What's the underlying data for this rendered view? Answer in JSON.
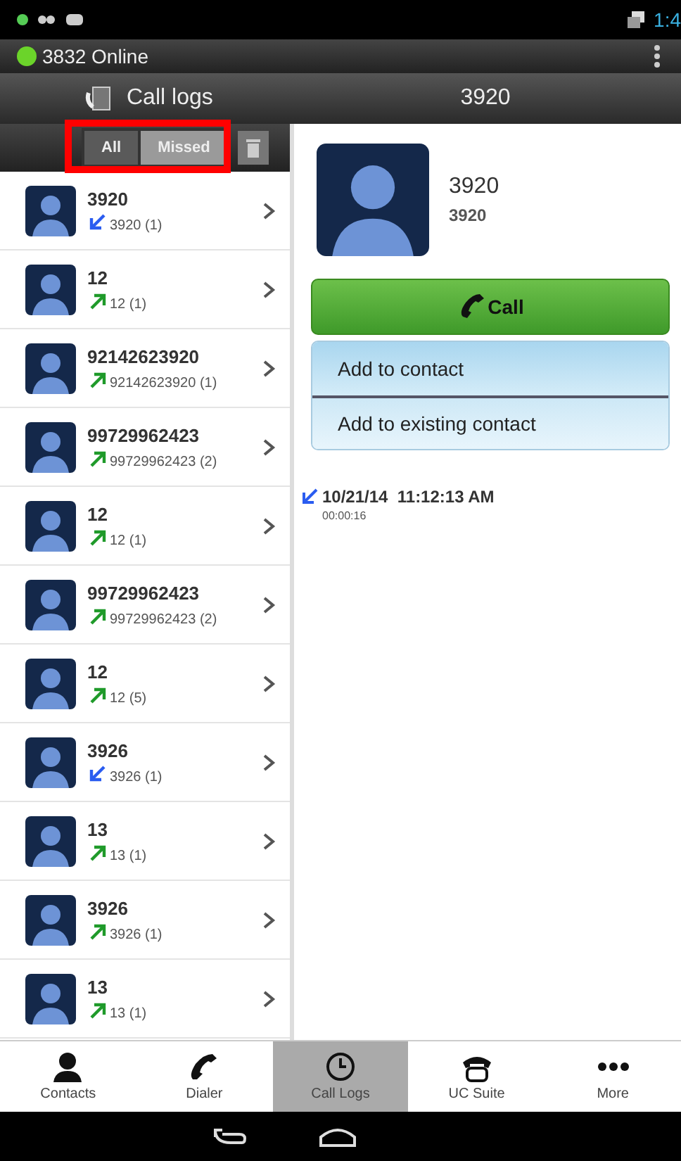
{
  "status_bar": {
    "time": "1:4"
  },
  "account": {
    "name": "3832 Online",
    "online": true
  },
  "header": {
    "title": "Call logs",
    "detail_title": "3920"
  },
  "filter_tabs": [
    {
      "label": "All",
      "selected": false
    },
    {
      "label": "Missed",
      "selected": true
    }
  ],
  "calls": [
    {
      "name": "3920",
      "kind": "incoming",
      "detail": "3920 (1)",
      "selected": false
    },
    {
      "name": "12",
      "kind": "outgoing",
      "detail": "12 (1)",
      "selected": false
    },
    {
      "name": "92142623920",
      "kind": "outgoing",
      "detail": "92142623920 (1)",
      "selected": false
    },
    {
      "name": "99729962423",
      "kind": "outgoing",
      "detail": "99729962423 (2)",
      "selected": false
    },
    {
      "name": "12",
      "kind": "outgoing",
      "detail": "12 (1)",
      "selected": false
    },
    {
      "name": "99729962423",
      "kind": "outgoing",
      "detail": "99729962423 (2)",
      "selected": false
    },
    {
      "name": "12",
      "kind": "outgoing",
      "detail": "12 (5)",
      "selected": false
    },
    {
      "name": "3926",
      "kind": "incoming",
      "detail": "3926 (1)",
      "selected": false
    },
    {
      "name": "13",
      "kind": "outgoing",
      "detail": "13 (1)",
      "selected": false
    },
    {
      "name": "3926",
      "kind": "outgoing",
      "detail": "3926 (1)",
      "selected": false
    },
    {
      "name": "13",
      "kind": "outgoing",
      "detail": "13 (1)",
      "selected": false
    }
  ],
  "detail": {
    "name": "3920",
    "number": "3920",
    "call_button": "Call",
    "actions": [
      "Add to contact",
      "Add to existing contact"
    ],
    "history": [
      {
        "kind": "incoming",
        "datetime": "10/21/14  11:12:13 AM",
        "duration": "00:00:16"
      }
    ]
  },
  "bottom_tabs": [
    {
      "label": "Contacts",
      "kind": "person",
      "selected": false
    },
    {
      "label": "Dialer",
      "kind": "handset",
      "selected": false
    },
    {
      "label": "Call Logs",
      "kind": "clock",
      "selected": true
    },
    {
      "label": "UC Suite",
      "kind": "phone",
      "selected": false
    },
    {
      "label": "More",
      "kind": "dots",
      "selected": false
    }
  ]
}
